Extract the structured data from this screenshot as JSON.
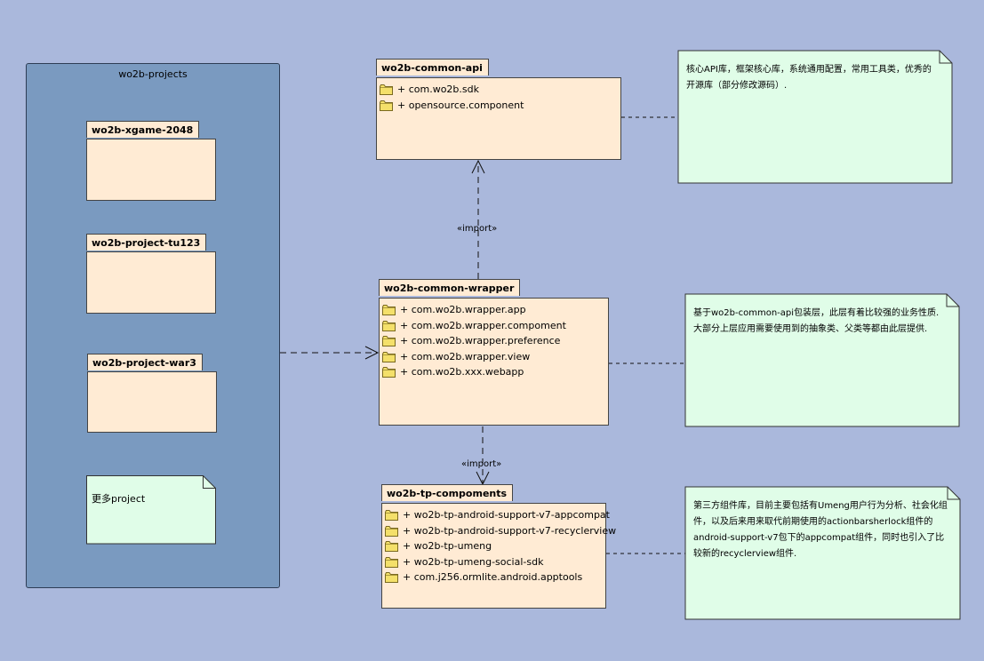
{
  "colors": {
    "background": "#aab8dc",
    "container_fill": "#7a9ac0",
    "package_fill": "#ffebd4",
    "note_fill": "#e0fde8",
    "folder_fill": "#f4e06a"
  },
  "container": {
    "title": "wo2b-projects"
  },
  "sub_packages": [
    {
      "name": "wo2b-xgame-2048"
    },
    {
      "name": "wo2b-project-tu123"
    },
    {
      "name": "wo2b-project-war3"
    }
  ],
  "more_note": {
    "text": "更多project"
  },
  "packages": {
    "common_api": {
      "name": "wo2b-common-api",
      "items": [
        "+ com.wo2b.sdk",
        "+ opensource.component"
      ]
    },
    "common_wrapper": {
      "name": "wo2b-common-wrapper",
      "items": [
        "+ com.wo2b.wrapper.app",
        "+ com.wo2b.wrapper.compoment",
        "+ com.wo2b.wrapper.preference",
        "+ com.wo2b.wrapper.view",
        "+ com.wo2b.xxx.webapp"
      ]
    },
    "tp_compoments": {
      "name": "wo2b-tp-compoments",
      "items": [
        "+ wo2b-tp-android-support-v7-appcompat",
        "+ wo2b-tp-android-support-v7-recyclerview",
        "+ wo2b-tp-umeng",
        "+ wo2b-tp-umeng-social-sdk",
        "+ com.j256.ormlite.android.apptools"
      ]
    }
  },
  "notes": {
    "api_note": "核心API库，框架核心库，系统通用配置，常用工具类，优秀的开源库（部分修改源码）.",
    "wrapper_note": "基于wo2b-common-api包装层，此层有着比较强的业务性质. 大部分上层应用需要使用到的抽象类、父类等都由此层提供.",
    "tp_note": "第三方组件库，目前主要包括有Umeng用户行为分析、社会化组件，以及后来用来取代前期使用的actionbarsherlock组件的android-support-v7包下的appcompat组件，同时也引入了比较新的recyclerview组件."
  },
  "edges": {
    "import_upper": "«import»",
    "import_lower": "«import»"
  }
}
